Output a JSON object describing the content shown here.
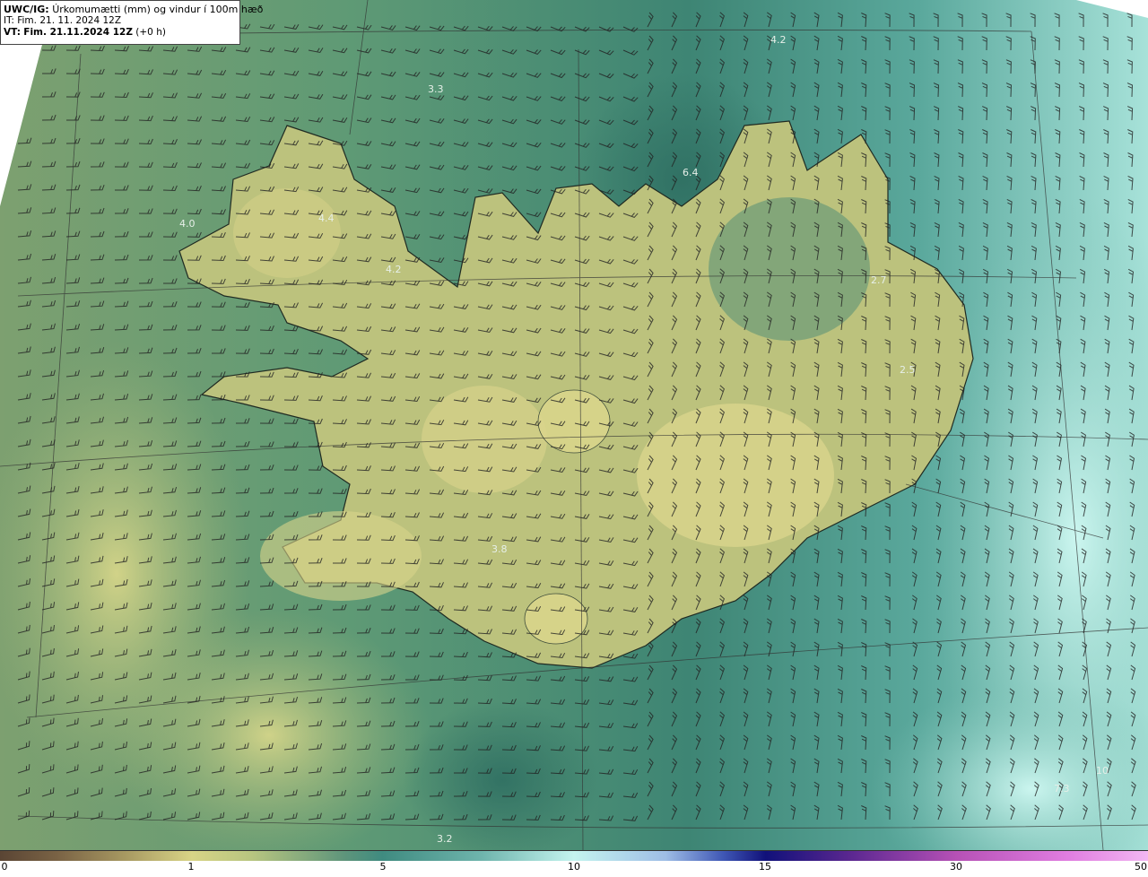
{
  "header": {
    "product": "UWC/IG:",
    "title": "Úrkomumætti (mm) og vindur í 100m hæð",
    "it_line": "IT: Fim. 21. 11. 2024 12Z",
    "vt_prefix": "VT:",
    "vt_bold": "Fim. 21.11.2024 12Z",
    "vt_suffix": "(+0 h)"
  },
  "map_labels": [
    {
      "text": "4.2"
    },
    {
      "text": "3.3"
    },
    {
      "text": "6.4"
    },
    {
      "text": "4.0"
    },
    {
      "text": "4.4"
    },
    {
      "text": "4.2"
    },
    {
      "text": "2.7"
    },
    {
      "text": "2.5"
    },
    {
      "text": "3.8"
    },
    {
      "text": "3.2"
    },
    {
      "text": "7.3"
    },
    {
      "text": "10"
    }
  ],
  "scale": {
    "ticks": [
      "0",
      "1",
      "5",
      "10",
      "15",
      "30",
      "50"
    ]
  },
  "colors": {
    "sea_dark": "#3f7e6e",
    "land_yellow": "#d8d486",
    "east_cyan": "#c4f4ef",
    "coastline": "#222222"
  }
}
